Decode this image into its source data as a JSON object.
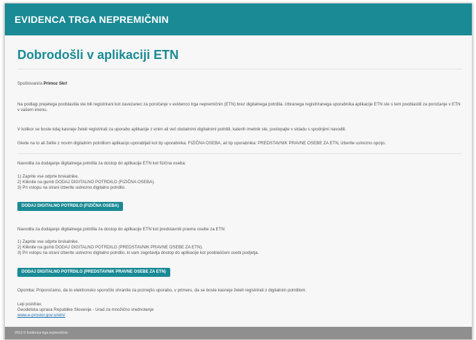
{
  "header": {
    "title": "EVIDENCA TRGA NEPREMIČNIN"
  },
  "page": {
    "heading": "Dobrodošli v aplikaciji ETN",
    "greeting_prefix": "Spoštovani/a",
    "greeting_name": "Primoz Skrl",
    "p1": "Na podlagi prejetega pooblastila ste bili registrirani kot zavezanec za poročanje v evidenco trga nepremičnin (ETN) brez digitalnega potrdila. Izbranega registriranega uporabnika aplikacije ETN ste s tem pooblastili za poročanje v ETN v vašem imenu.",
    "p2": "V kolikor se boste kdaj kasneje želeli registrirati za uporabo aplikacije z enim ali več dodatnimi digitalnimi potrdili, katerih imetnik ste, postopajte v skladu s spodnjimi navodili.",
    "p3": "Glede na to ali želite z novim digitalnim potrdilom aplikacijo uporabljati kot tip uporabnika: FIZIČNA OSEBA, ali tip uporabnika: PREDSTAVNIK PRAVNE OSEBE ZA ETN, izberite ustrezno opcijo.",
    "section1": {
      "intro": "Navodila za dodajanje digitalnega potrdila za dostop do aplikacije ETN kot fizična oseba:",
      "steps": [
        "1) Zaprite vse odprte brskalnike.",
        "2) Kliknite na gumb DODAJ DIGITALNO POTRDILO (FIZIČNA OSEBA).",
        "3) Pri vstopu na strani izberite ustrezno digitalno potrdilo."
      ],
      "button": "DODAJ DIGITALNO POTRDILO (FIZIČNA OSEBA)"
    },
    "section2": {
      "intro": "Navodila za dodajanje digitalnega potrdila za dostop do aplikacije ETN kot predstavnik pravne osebe za ETN:",
      "steps": [
        "1) Zaprite vse odprte brskalnike.",
        "2) Kliknite na gumb DODAJ DIGITALNO POTRDILO (PREDSTAVNIK PRAVNE OSEBE ZA ETN).",
        "3) Pri vstopu na strani izberite ustrezno digitalno potrdilo, ki vam zagotavlja dostop do aplikacije kot pooblaščeni osebi podjetja."
      ],
      "button": "DODAJ DIGITALNO POTRDILO (PREDSTAVNIK PRAVNE OSEBE ZA ETN)"
    },
    "note": "Opomba: Priporočamo, da to elektronsko sporočilo shranite za poznejšo uporabo, v primeru, da se boste kasneje želeli registrirati z digitalnim potrdilom.",
    "closing": "Lep pozdrav,",
    "signature": "Geodetska uprava Republike Slovenije - Urad za množično vrednotenje",
    "link": "www.e-prostor.gov.si/etn/"
  },
  "footer": {
    "copyright": "2013 © Evidenca trga nepremičnin"
  }
}
